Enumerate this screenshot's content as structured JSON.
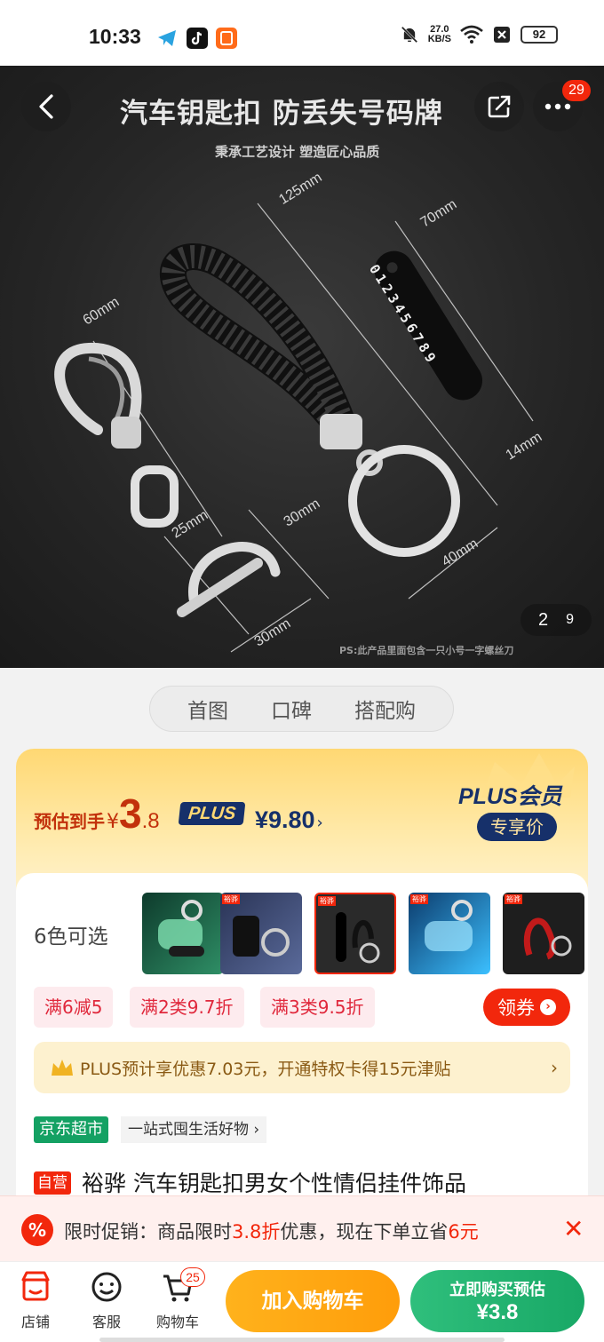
{
  "status_bar": {
    "time": "10:33",
    "net_speed_value": "27.0",
    "net_speed_unit": "KB/S",
    "battery": "92"
  },
  "hero": {
    "title": "汽车钥匙扣 防丢失号码牌",
    "subtitle": "秉承工艺设计 塑造匠心品质",
    "note": "PS:此产品里面包含一只小号一字螺丝刀",
    "dims": {
      "d60": "60mm",
      "d125": "125mm",
      "d70": "70mm",
      "d14": "14mm",
      "d25": "25mm",
      "d30a": "30mm",
      "d30b": "30mm",
      "d40": "40mm"
    },
    "plate_digits": "0123456789",
    "more_badge": "29",
    "pager": {
      "current": "2",
      "total": "9"
    }
  },
  "tabs": [
    "首图",
    "口碑",
    "搭配购"
  ],
  "price": {
    "label": "预估到手",
    "yen": "¥",
    "int": "3",
    "dec": ".8",
    "plus_tag": "PLUS",
    "plus_price": "¥9.80",
    "plus_arrow": "›",
    "plus_brand": "PLUS会员",
    "plus_pill": "专享价"
  },
  "colors": {
    "label": "6色可选",
    "thumb_tags": [
      "",
      "裕骅",
      "裕骅",
      "裕骅",
      "裕骅"
    ]
  },
  "coupons": [
    "满6减5",
    "满2类9.7折",
    "满3类9.5折"
  ],
  "lingquan": "领券",
  "plus_bar": {
    "text": "PLUS预计享优惠7.03元，开通特权卡得15元津贴",
    "chevron": "›"
  },
  "market": {
    "tag": "京东超市",
    "sub": "一站式囤生活好物 ›"
  },
  "product": {
    "self_tag": "自营",
    "title": "裕骅 汽车钥匙扣男女个性情侣挂件饰品"
  },
  "promo": {
    "icon": "%",
    "t1": "限时促销：商品限时",
    "t2": "3.8折",
    "t3": "优惠，现在下单立省",
    "t4": "6元",
    "close": "✕"
  },
  "bottom": {
    "store": "店铺",
    "service": "客服",
    "cart": "购物车",
    "cart_count": "25",
    "add_cart": "加入购物车",
    "buy_line1": "立即购买预估",
    "buy_line2": "¥3.8"
  },
  "colors_theme": {
    "jd_red": "#f2270c",
    "plus_navy": "#16306a",
    "market_green": "#14a163"
  }
}
